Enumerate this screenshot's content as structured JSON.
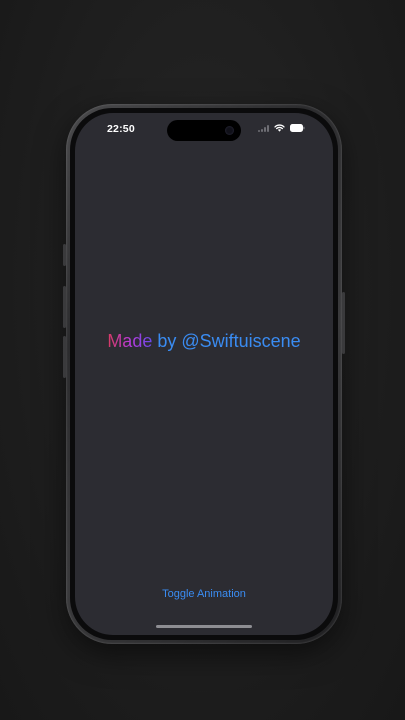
{
  "status_bar": {
    "time": "22:50",
    "icons": [
      "signal-icon",
      "wifi-icon",
      "battery-icon"
    ]
  },
  "main": {
    "credit_highlight": "Made",
    "credit_rest": " by @Swiftuiscene",
    "toggle_label": "Toggle Animation"
  },
  "colors": {
    "screen_background": "#2c2c32",
    "accent_blue": "#3a8cf2",
    "gradient_start": "#d83a5e",
    "gradient_end": "#6a4ae8"
  }
}
